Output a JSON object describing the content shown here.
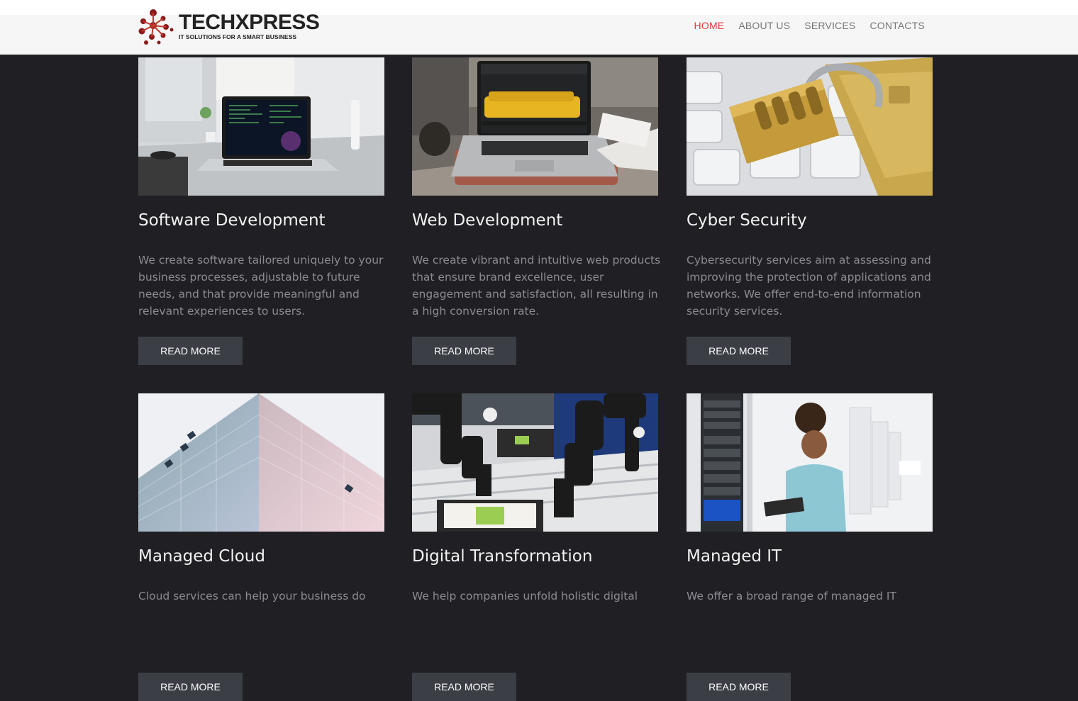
{
  "header": {
    "logo_name": "TECHXPRESS",
    "logo_tagline": "IT SOLUTIONS FOR A SMART BUSINESS",
    "nav": [
      {
        "label": "HOME",
        "active": true
      },
      {
        "label": "ABOUT US",
        "active": false
      },
      {
        "label": "SERVICES",
        "active": false
      },
      {
        "label": "CONTACTS",
        "active": false
      }
    ],
    "accent_color": "#e53a3a"
  },
  "services": [
    {
      "title": "Software Development",
      "description": "We create software tailored uniquely to your business processes, adjustable to future needs, and that provide meaningful and relevant experiences to users.",
      "button": "READ MORE",
      "image": "laptop-code-image"
    },
    {
      "title": "Web Development",
      "description": "We create vibrant and intuitive web products that ensure brand excellence, user engagement and satisfaction, all resulting in a high conversion rate.",
      "button": "READ MORE",
      "image": "laptop-website-image"
    },
    {
      "title": "Cyber Security",
      "description": "Cybersecurity services aim at assessing and improving the protection of applications and networks. We offer end-to-end information security services.",
      "button": "READ MORE",
      "image": "padlock-keyboard-image"
    },
    {
      "title": "Managed Cloud",
      "description": "Cloud services can help your business do",
      "button": "READ MORE",
      "image": "glass-building-image"
    },
    {
      "title": "Digital Transformation",
      "description": "We help companies unfold holistic digital",
      "button": "READ MORE",
      "image": "robot-arms-image"
    },
    {
      "title": "Managed IT",
      "description": "We offer a broad range of managed IT",
      "button": "READ MORE",
      "image": "server-room-image"
    }
  ]
}
